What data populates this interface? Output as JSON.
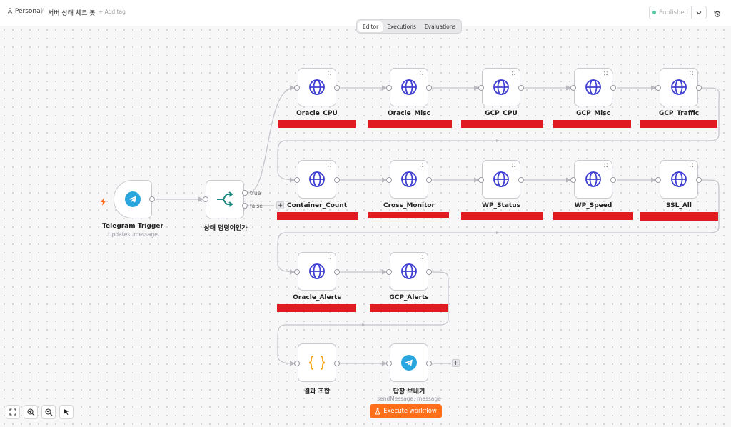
{
  "header": {
    "workspace": "Personal",
    "separator": "/",
    "workflow_name": "서버 상태 체크 봇",
    "add_tag": "+ Add tag",
    "published_label": "Published"
  },
  "tabs": [
    {
      "label": "Editor",
      "active": true
    },
    {
      "label": "Executions",
      "active": false
    },
    {
      "label": "Evaluations",
      "active": false
    }
  ],
  "nodes": {
    "trigger": {
      "label": "Telegram Trigger",
      "sub": "Updates: message",
      "icon": "telegram-icon"
    },
    "if": {
      "label": "상태 명령어인가",
      "true_label": "true",
      "false_label": "false",
      "icon": "if-branch-icon"
    },
    "row1": [
      "Oracle_CPU",
      "Oracle_Misc",
      "GCP_CPU",
      "GCP_Misc",
      "GCP_Traffic"
    ],
    "row2": [
      "Container_Count",
      "Cross_Monitor",
      "WP_Status",
      "WP_Speed",
      "SSL_All"
    ],
    "row3": [
      "Oracle_Alerts",
      "GCP_Alerts"
    ],
    "combine": {
      "label": "결과 조합",
      "icon": "code-braces-icon"
    },
    "reply": {
      "label": "답장 보내기",
      "sub": "sendMessage: message",
      "icon": "telegram-icon"
    }
  },
  "execute_button": "Execute workflow",
  "colors": {
    "accent": "#ff6f1a",
    "http_icon": "#3f3fd1",
    "telegram": "#2aa6df",
    "if_icon": "#1b8a7f",
    "code_icon": "#f5a623",
    "redaction": "#e11b22"
  }
}
